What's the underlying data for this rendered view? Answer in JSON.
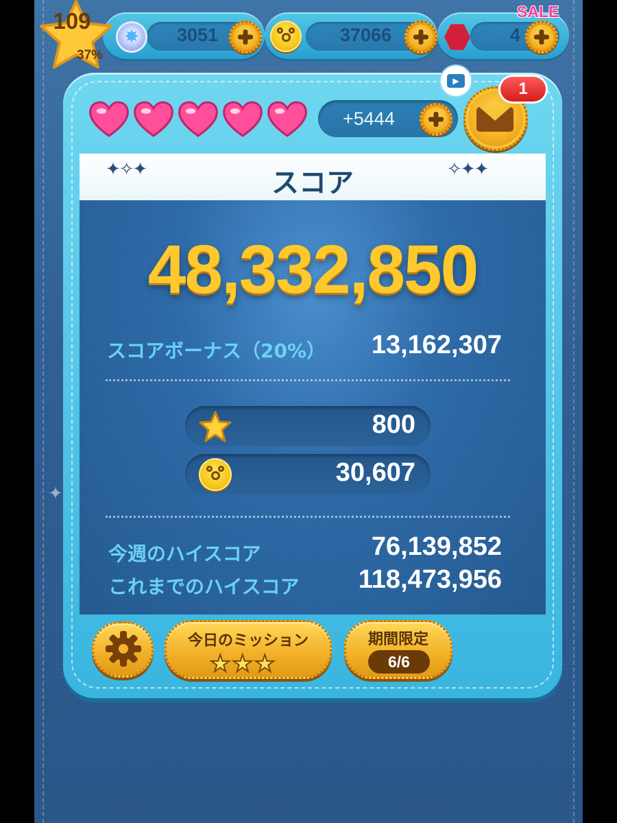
{
  "top_bar": {
    "level": "109",
    "level_progress": "37%",
    "crystals": "3051",
    "coins": "37066",
    "rubies": "4",
    "sale_label": "SALE"
  },
  "hearts": {
    "count": 5,
    "time_bonus": "+5444"
  },
  "mail": {
    "badge_count": "1"
  },
  "result": {
    "title": "スコア",
    "score": "48,332,850",
    "bonus_label": "スコアボーナス（20%）",
    "bonus_value": "13,162,307",
    "exp_value": "800",
    "coins_earned": "30,607",
    "weekly_high_label": "今週のハイスコア",
    "weekly_high_value": "76,139,852",
    "alltime_high_label": "これまでのハイスコア",
    "alltime_high_value": "118,473,956"
  },
  "buttons": {
    "mission_label": "今日のミッション",
    "mission_stars": "★★★",
    "limited_label": "期間限定",
    "limited_count": "6/6"
  },
  "icons": {
    "settings": "gear-icon",
    "mail": "envelope-icon",
    "video": "video-icon",
    "exp": "star-icon",
    "coin": "mickey-coin-icon",
    "crystal": "crystal-icon",
    "ruby": "ruby-icon"
  },
  "colors": {
    "score_gold": "#ffc92e",
    "label_cyan": "#6ad2f5",
    "panel_frame": "#39b5df",
    "button_gold": "#f3b22a"
  }
}
